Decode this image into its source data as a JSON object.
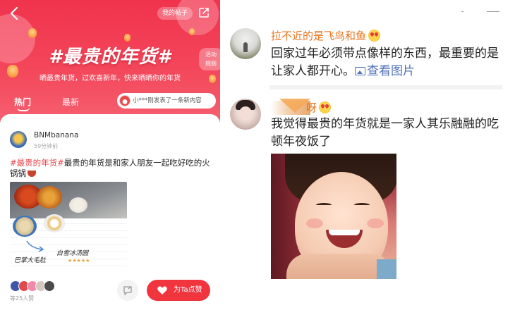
{
  "left_panel": {
    "header": {
      "my_posts_label": "我的帖子",
      "title": "#最贵的年货#",
      "subtitle": "晒最贵年货，过欢喜新年，快来晒晒你的年货",
      "rules_label_line1": "活动",
      "rules_label_line2": "规则"
    },
    "tabs": [
      {
        "label": "热门",
        "active": true
      },
      {
        "label": "最新",
        "active": false
      }
    ],
    "ticker_text": "小***刚发表了一条新内容",
    "post": {
      "author": "BNMbanana",
      "time": "59分钟前",
      "hashtag": "#最贵的年货#",
      "text": "最贵的年货是和家人朋友一起吃好吃的火锅锅",
      "photo_labels": {
        "dumpling": "白雪冰汤圆",
        "tripe": "巴掌大毛肚",
        "stars": "★★★★★"
      },
      "liked_count_text": "等25人赞",
      "like_button_label": "为Ta点赞"
    }
  },
  "right_panel": {
    "comments": [
      {
        "name": "拉不近的是飞鸟和鱼",
        "text": "回家过年必须带点像样的东西，最重要的是让家人都开心。",
        "view_image_label": "查看图片"
      },
      {
        "name": "呀",
        "text": "我觉得最贵的年货就是一家人其乐融融的吃顿年夜饭了"
      }
    ]
  },
  "colors": {
    "banner_red": "#f0334d",
    "like_button_red": "#f0353f",
    "hashtag_red": "#e8434b",
    "commenter_name_orange": "#e9751f",
    "link_blue": "#4e72b8"
  },
  "icons": [
    "back-arrow-icon",
    "share-icon",
    "comment-icon",
    "heart-icon",
    "emoji-heart-eyes-icon",
    "image-icon"
  ]
}
